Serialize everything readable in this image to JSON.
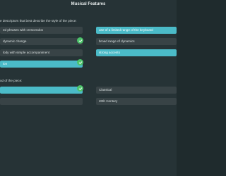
{
  "window": {
    "title": "Musical Features"
  },
  "question1": {
    "prompt": "e descriptors that best describe the style of the piece:",
    "options": [
      {
        "label": "ed phrases with crescendos",
        "selected": false
      },
      {
        "label": "use of a limited range of the keyboard",
        "selected": true
      },
      {
        "label": "dynamic change",
        "selected": false
      },
      {
        "label": "broad range of dynamics",
        "selected": false
      },
      {
        "label": "lody with simple accompaniment",
        "selected": false
      },
      {
        "label": "strong accents",
        "selected": true
      },
      {
        "label": "ion",
        "selected": true
      }
    ]
  },
  "question2": {
    "prompt": "od of the piece:",
    "options": [
      {
        "label": "",
        "selected": true
      },
      {
        "label": "Classical",
        "selected": false
      },
      {
        "label": "",
        "selected": false
      },
      {
        "label": "20th Century",
        "selected": false
      }
    ]
  },
  "colors": {
    "background": "#263336",
    "option_bg": "#384346",
    "selected_bg": "#4bbbc8",
    "check_green": "#4cc36a"
  },
  "icons": {
    "selection_mark": "check-circle-icon"
  }
}
